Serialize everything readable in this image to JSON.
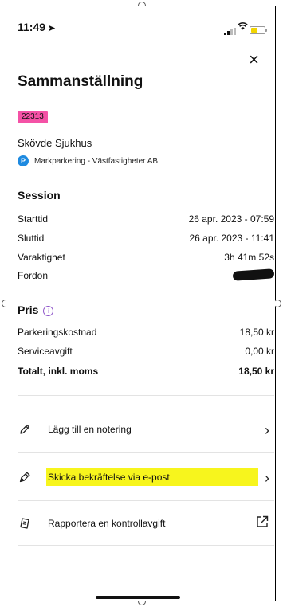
{
  "status_bar": {
    "time": "11:49",
    "location_arrow": "➤"
  },
  "header": {
    "close_icon": "×",
    "title": "Sammanställning"
  },
  "parking": {
    "zone_code": "22313",
    "place_name": "Skövde Sjukhus",
    "provider_icon_letter": "P",
    "provider": "Markparkering - Västfastigheter AB"
  },
  "session": {
    "heading": "Session",
    "rows": [
      {
        "label": "Starttid",
        "value": "26 apr. 2023 - 07:59"
      },
      {
        "label": "Sluttid",
        "value": "26 apr. 2023 - 11:41"
      },
      {
        "label": "Varaktighet",
        "value": "3h 41m 52s"
      },
      {
        "label": "Fordon",
        "value": ""
      }
    ]
  },
  "price": {
    "heading": "Pris",
    "info_icon": "i",
    "rows": [
      {
        "label": "Parkeringskostnad",
        "value": "18,50 kr"
      },
      {
        "label": "Serviceavgift",
        "value": "0,00 kr"
      }
    ],
    "total": {
      "label": "Totalt, inkl. moms",
      "value": "18,50 kr"
    }
  },
  "actions": [
    {
      "label": "Lägg till en notering",
      "icon": "pencil-icon",
      "trail": "chevron"
    },
    {
      "label": "Skicka bekräftelse via e-post",
      "icon": "pen-nib-icon",
      "trail": "chevron",
      "highlight": "#f7f51d"
    },
    {
      "label": "Rapportera en kontrollavgift",
      "icon": "ticket-icon",
      "trail": "external-link"
    }
  ],
  "colors": {
    "zone_badge": "#f452a6",
    "provider_badge": "#1e8ae0",
    "info_icon": "#8e55c9",
    "highlight": "#f7f51d"
  }
}
